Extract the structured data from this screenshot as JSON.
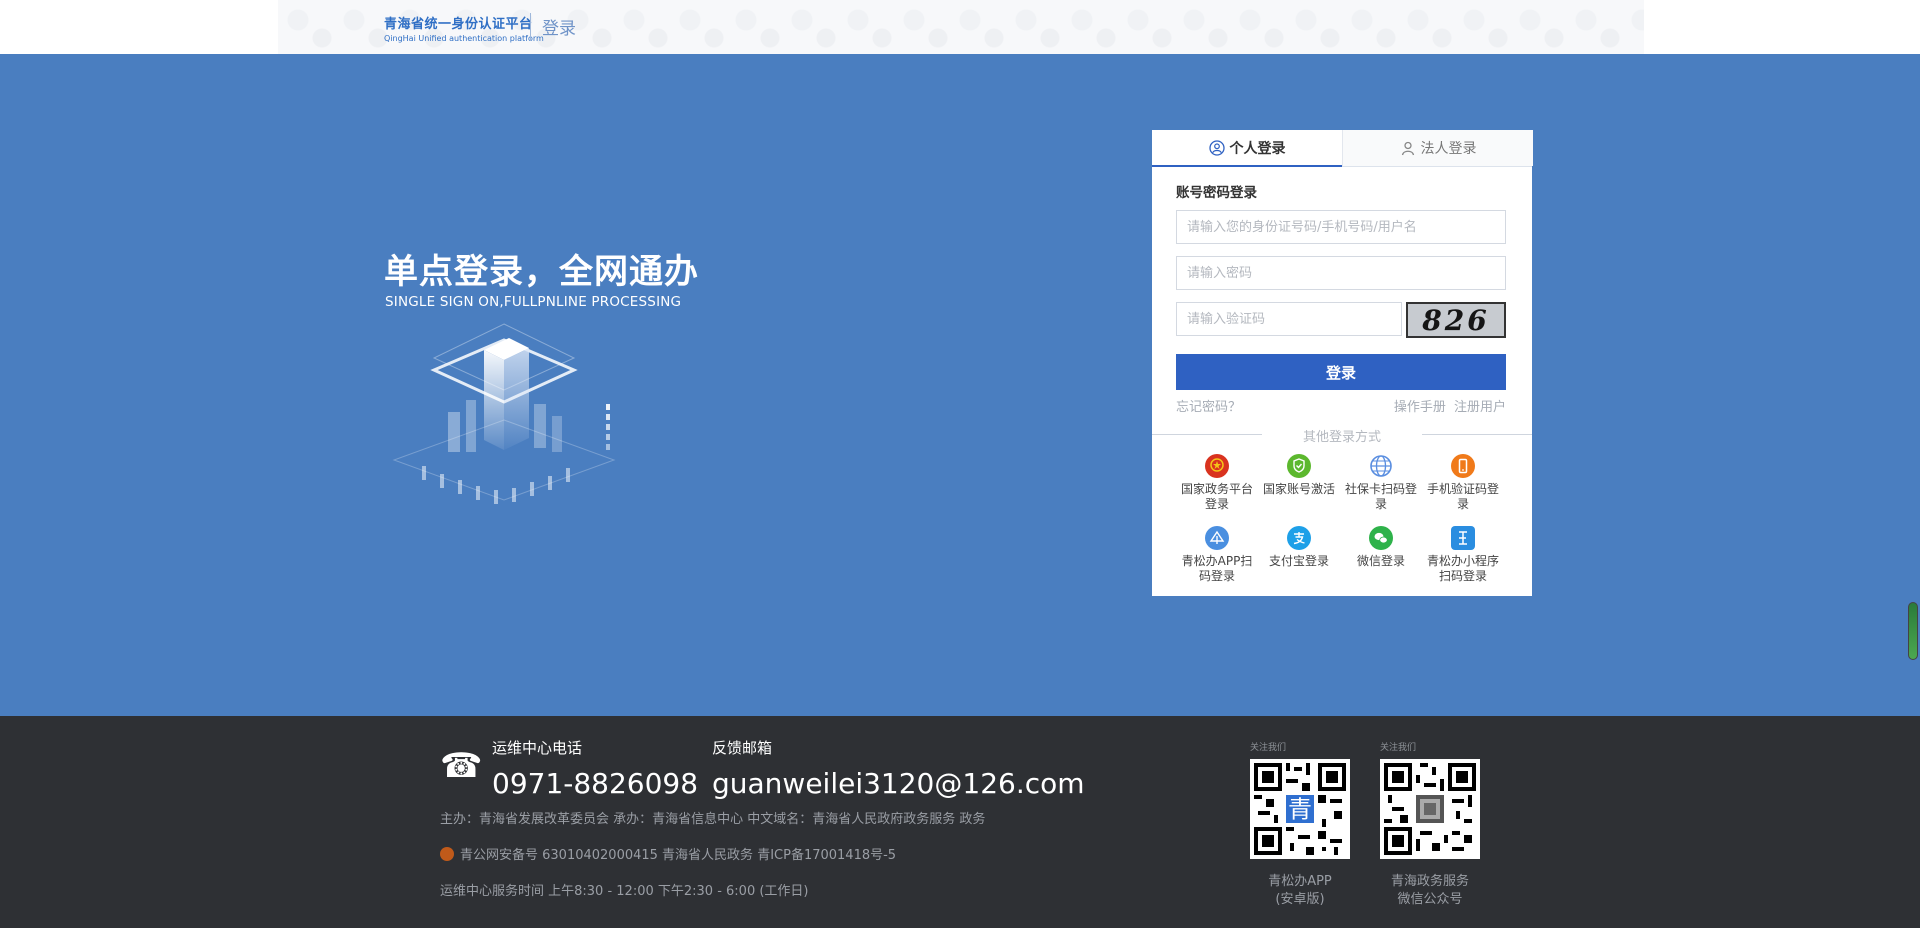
{
  "header": {
    "logo_cn": "青海省统一身份认证平台",
    "logo_en": "QingHai Unified authentication platform",
    "page_title": "登录"
  },
  "hero": {
    "slogan_cn": "单点登录，全网通办",
    "slogan_en": "SINGLE SIGN ON,FULLPNLINE PROCESSING"
  },
  "login": {
    "tabs": [
      {
        "label": "个人登录",
        "icon": "person-icon"
      },
      {
        "label": "法人登录",
        "icon": "corporate-person-icon"
      }
    ],
    "subtitle": "账号密码登录",
    "username_placeholder": "请输入您的身份证号码/手机号码/用户名",
    "password_placeholder": "请输入密码",
    "captcha_placeholder": "请输入验证码",
    "captcha_text": "826",
    "submit_label": "登录",
    "forgot_label": "忘记密码？",
    "manual_label": "操作手册",
    "register_label": "注册用户",
    "other_methods_title": "其他登录方式",
    "methods": [
      {
        "label": "国家政务平台登录",
        "icon": "national-emblem-icon",
        "color": "#d9331f"
      },
      {
        "label": "国家账号激活",
        "icon": "shield-check-icon",
        "color": "#5cb82e"
      },
      {
        "label": "社保卡扫码登录",
        "icon": "globe-icon",
        "color": "#5a8ee0"
      },
      {
        "label": "手机验证码登录",
        "icon": "mobile-phone-icon",
        "color": "#f07a1a"
      },
      {
        "label": "青松办APP扫码登录",
        "icon": "qingsong-app-icon",
        "color": "#4a8fe0"
      },
      {
        "label": "支付宝登录",
        "icon": "alipay-icon",
        "color": "#1ea0e8"
      },
      {
        "label": "微信登录",
        "icon": "wechat-icon",
        "color": "#2eb24a"
      },
      {
        "label": "青松办小程序扫码登录",
        "icon": "mini-program-icon",
        "color": "#2a8de0"
      }
    ]
  },
  "footer": {
    "ops_label": "运维中心电话",
    "ops_phone": "0971-8826098",
    "mail_label": "反馈邮箱",
    "mail_addr": "guanweilei3120@126.com",
    "line1": "主办：青海省发展改革委员会   承办：青海省信息中心   中文域名：青海省人民政府政务服务 政务",
    "line2": "青公网安备号 63010402000415  青海省人民政务 青ICP备17001418号-5",
    "line3": "运维中心服务时间  上午8:30 - 12:00  下午2:30 - 6:00 (工作日)",
    "qr1": {
      "caption": "关注我们",
      "label1": "青松办APP",
      "label2": "(安卓版)"
    },
    "qr2": {
      "caption": "关注我们",
      "label1": "青海政务服务",
      "label2": "微信公众号"
    }
  },
  "colors": {
    "hero_bg": "#4a7ec0",
    "primary": "#2f61c2",
    "footer_bg": "#2e3034"
  }
}
